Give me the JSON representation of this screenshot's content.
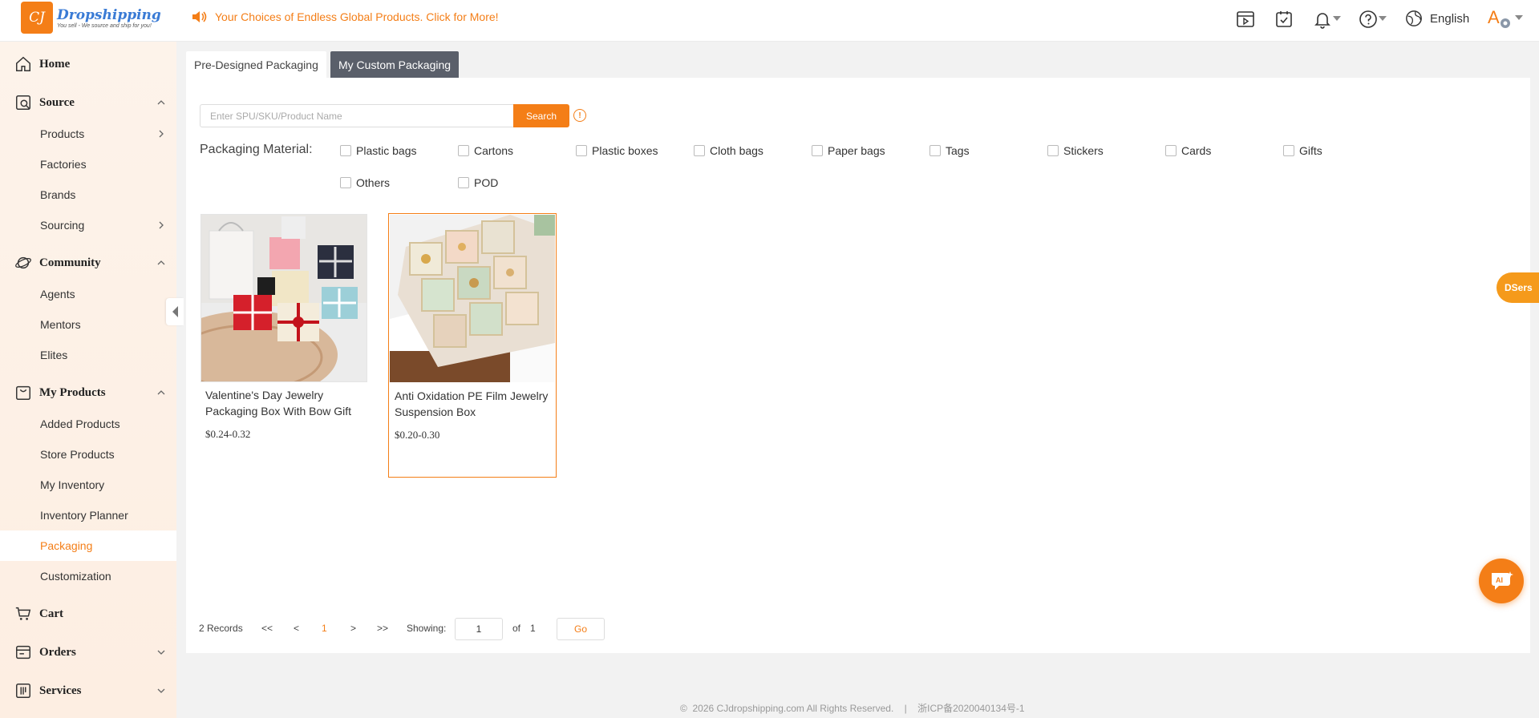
{
  "header": {
    "logo_mark": "CJ",
    "logo_name": "Dropshipping",
    "logo_tagline": "You sell - We source and ship for you!",
    "announcement": "Your Choices of Endless Global Products. Click for More!",
    "language": "English",
    "avatar_letter": "A",
    "brand_color": "#f47e17"
  },
  "sidebar": {
    "groups": [
      {
        "label": "Home",
        "icon": "home-icon"
      },
      {
        "label": "Source",
        "icon": "source-icon",
        "items": [
          "Products",
          "Factories",
          "Brands",
          "Sourcing"
        ]
      },
      {
        "label": "Community",
        "icon": "community-icon",
        "items": [
          "Agents",
          "Mentors",
          "Elites"
        ]
      },
      {
        "label": "My Products",
        "icon": "box-icon",
        "items": [
          "Added Products",
          "Store Products",
          "My Inventory",
          "Inventory Planner",
          "Packaging",
          "Customization"
        ]
      },
      {
        "label": "Cart",
        "icon": "cart-icon"
      },
      {
        "label": "Orders",
        "icon": "orders-icon"
      },
      {
        "label": "Services",
        "icon": "services-icon"
      }
    ],
    "active_item": "Packaging"
  },
  "tabs": [
    {
      "label": "Pre-Designed Packaging",
      "active": false
    },
    {
      "label": "My Custom Packaging",
      "active": true
    }
  ],
  "search": {
    "placeholder": "Enter SPU/SKU/Product Name",
    "button": "Search",
    "info": "!"
  },
  "filters": {
    "label": "Packaging Material:",
    "options": [
      "Plastic bags",
      "Cartons",
      "Plastic boxes",
      "Cloth bags",
      "Paper bags",
      "Tags",
      "Stickers",
      "Cards",
      "Gifts",
      "Others",
      "POD"
    ]
  },
  "products": [
    {
      "title": "Valentine's Day Jewelry Packaging Box With Bow Gift",
      "price": "$0.24-0.32"
    },
    {
      "title": "Anti Oxidation PE Film Jewelry Suspension Box",
      "price": "$0.20-0.30"
    }
  ],
  "pagination": {
    "records": "2 Records",
    "first": "<<",
    "prev": "<",
    "current": "1",
    "next": ">",
    "last": ">>",
    "showing_label": "Showing:",
    "page_value": "1",
    "of_label": "of",
    "total_pages": "1",
    "go": "Go"
  },
  "footer": {
    "copyright": "©  2026 CJdropshipping.com All Rights Reserved.",
    "separator": "|",
    "icp": "浙ICP备2020040134号-1"
  },
  "floating": {
    "dsers": "DSers",
    "ai": "AI"
  }
}
